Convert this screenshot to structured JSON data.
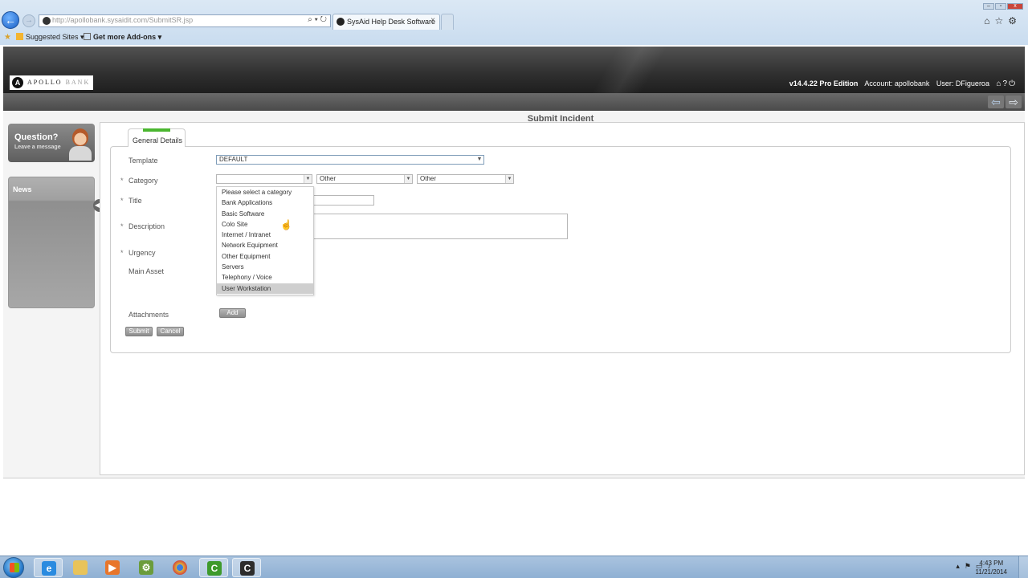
{
  "browser": {
    "url": "http://apollobank.sysaidit.com/SubmitSR.jsp",
    "tab_title": "SysAid Help Desk Software",
    "tab_close": "×",
    "favorites": [
      {
        "label": "Suggested Sites ▾"
      },
      {
        "label": "Get more Add-ons ▾"
      }
    ]
  },
  "header": {
    "logo_mark": "A",
    "logo_word1": "APOLLO ",
    "logo_word2": "BANK",
    "version": "v14.4.22 Pro Edition",
    "account": "Account: apollobank",
    "user": "User: DFigueroa"
  },
  "page": {
    "title": "Submit Incident"
  },
  "sidebar": {
    "question_title": "Question?",
    "question_sub": "Leave a message",
    "news_title": "News"
  },
  "form": {
    "tab_label": "General Details",
    "required_marker": "*",
    "labels": {
      "template": "Template",
      "category": "Category",
      "title": "Title",
      "description": "Description",
      "urgency": "Urgency",
      "main_asset": "Main Asset",
      "attachments": "Attachments"
    },
    "template_value": "DEFAULT",
    "category_value": "",
    "subcategory_value": "Other",
    "third_level_value": "Other",
    "category_options": [
      "Please select a category",
      "Bank Applications",
      "Basic Software",
      "Colo Site",
      "Internet / Intranet",
      "Network Equipment",
      "Other Equipment",
      "Servers",
      "Telephony / Voice",
      "User Workstation"
    ],
    "highlighted_option": "User Workstation",
    "add_button": "Add",
    "submit_button": "Submit",
    "cancel_button": "Cancel"
  },
  "taskbar": {
    "time": "4:43 PM",
    "date": "11/21/2014"
  }
}
